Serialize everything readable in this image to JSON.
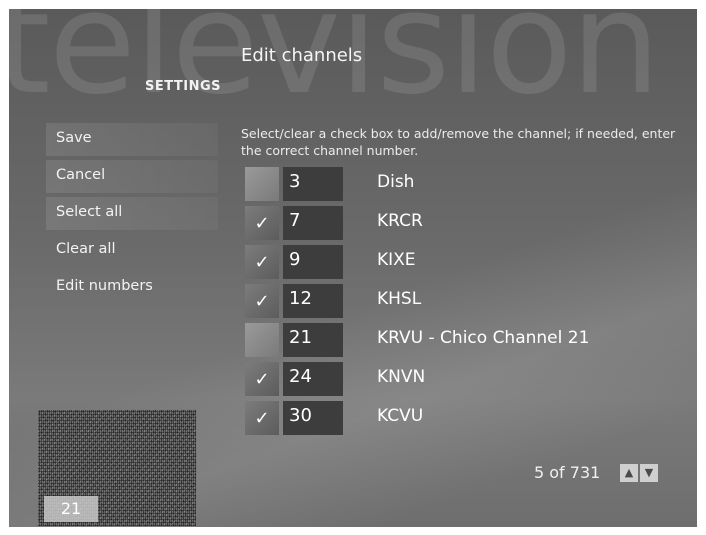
{
  "watermark": "television",
  "section": "SETTINGS",
  "title": "Edit channels",
  "instructions": "Select/clear a check box to add/remove the channel; if needed, enter the correct channel number.",
  "menu": [
    {
      "label": "Save"
    },
    {
      "label": "Cancel"
    },
    {
      "label": "Select all"
    },
    {
      "label": "Clear all"
    },
    {
      "label": "Edit numbers"
    }
  ],
  "check_mark": "✓",
  "channels": [
    {
      "checked": false,
      "number": "3",
      "name": "Dish"
    },
    {
      "checked": true,
      "number": "7",
      "name": "KRCR"
    },
    {
      "checked": true,
      "number": "9",
      "name": "KIXE"
    },
    {
      "checked": true,
      "number": "12",
      "name": "KHSL"
    },
    {
      "checked": false,
      "number": "21",
      "name": "KRVU - Chico Channel 21"
    },
    {
      "checked": true,
      "number": "24",
      "name": "KNVN"
    },
    {
      "checked": true,
      "number": "30",
      "name": "KCVU"
    }
  ],
  "pager": {
    "text": "5 of 731",
    "up_icon": "chevron-up-icon",
    "down_icon": "chevron-down-icon"
  },
  "preview": {
    "channel": "21"
  }
}
